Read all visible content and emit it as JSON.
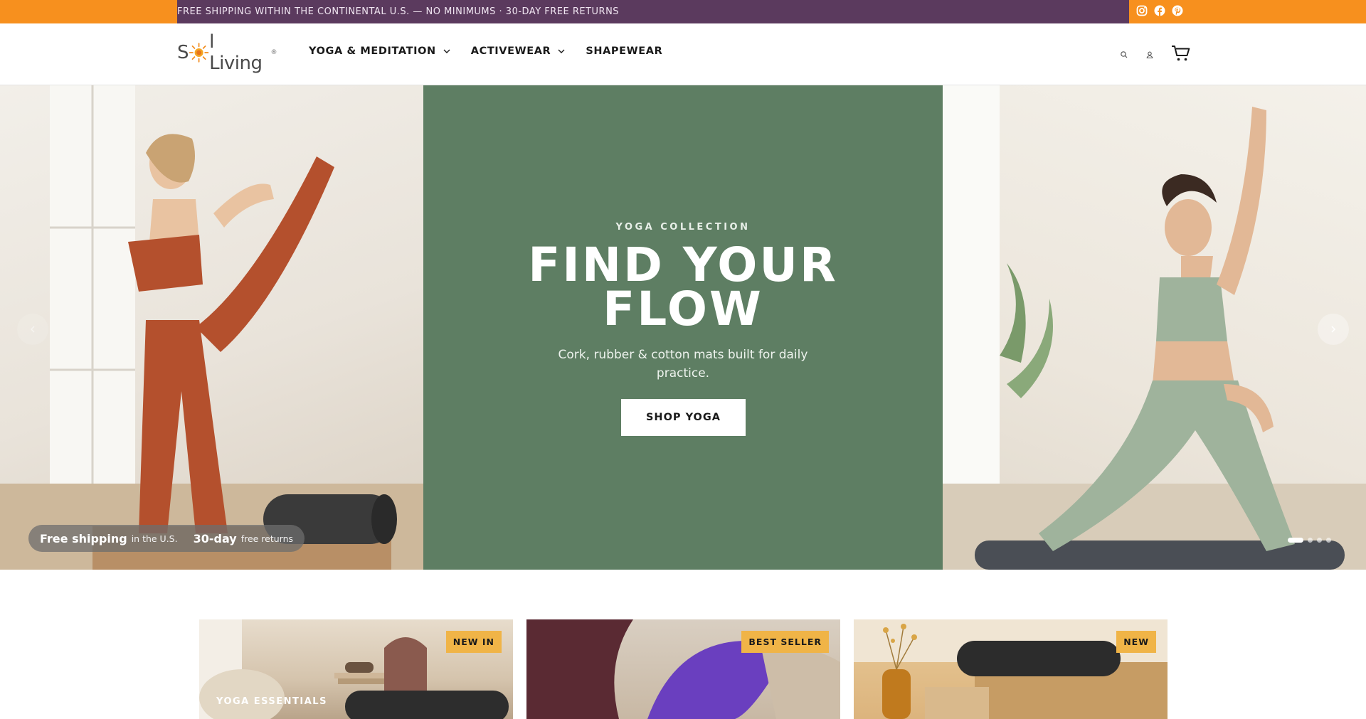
{
  "announcement": {
    "text": "FREE SHIPPING WITHIN THE CONTINENTAL U.S. — NO MINIMUMS · 30-DAY FREE RETURNS",
    "bar_color": "#5b3a5e",
    "edge_color": "#f7901e"
  },
  "social": [
    {
      "icon": "instagram-icon"
    },
    {
      "icon": "facebook-icon"
    },
    {
      "icon": "pinterest-icon"
    }
  ],
  "brand": {
    "logo_part1": "S",
    "logo_part2": "l Living",
    "reg": "®"
  },
  "nav": [
    {
      "label": "YOGA & MEDITATION",
      "dropdown": true
    },
    {
      "label": "ACTIVEWEAR",
      "dropdown": true
    },
    {
      "label": "SHAPEWEAR",
      "dropdown": false
    }
  ],
  "header_icons": [
    "search-icon",
    "account-icon",
    "cart-icon"
  ],
  "hero": {
    "eyebrow": "YOGA COLLECTION",
    "title_line1": "FIND YOUR",
    "title_line2": "FLOW",
    "subtitle": "Cork, rubber & cotton mats built for daily practice.",
    "cta": "SHOP YOGA",
    "panel_color": "#5e7e63",
    "pill": {
      "b1": "Free shipping",
      "s1": "in the U.S.",
      "b2": "30-day",
      "s2": "free returns"
    },
    "slides": 4,
    "active_slide": 1
  },
  "cards": [
    {
      "badge": "NEW IN",
      "label": "YOGA ESSENTIALS"
    },
    {
      "badge": "BEST SELLER",
      "label": ""
    },
    {
      "badge": "NEW",
      "label": ""
    }
  ]
}
